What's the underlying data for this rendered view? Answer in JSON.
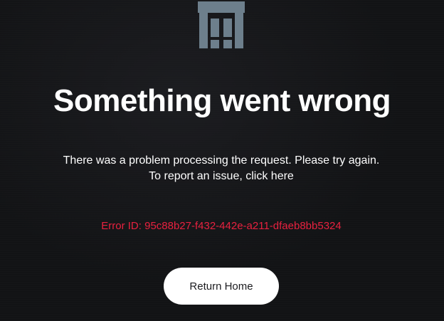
{
  "logo": {
    "icon": "brand-logo-icon",
    "color": "#6d7f8c"
  },
  "error_page": {
    "title": "Something went wrong",
    "message_line1": "There was a problem processing the request. Please try again.",
    "report_prefix": "To report an issue, ",
    "report_link": "click here",
    "error_id": "Error ID: 95c88b27-f432-442e-a211-dfaeb8bb5324",
    "return_button": "Return Home"
  },
  "colors": {
    "background": "#121315",
    "text": "#ffffff",
    "error": "#e8213f",
    "button_bg": "#ffffff",
    "button_text": "#1b1b1f"
  }
}
